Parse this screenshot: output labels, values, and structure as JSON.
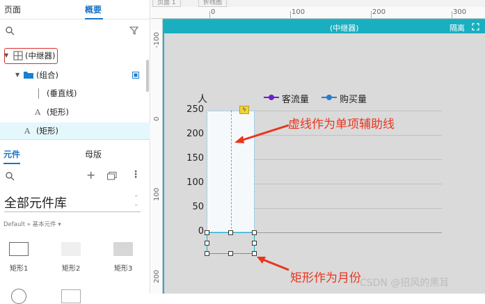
{
  "left_panel": {
    "tabs": [
      {
        "label": "页面"
      },
      {
        "label": "概要"
      }
    ],
    "outline": [
      {
        "label": "(中继器)"
      },
      {
        "label": "(组合)"
      },
      {
        "label": "(垂直线)"
      },
      {
        "label": "(矩形)"
      },
      {
        "label": "(矩形)"
      }
    ],
    "lib_tabs": [
      {
        "label": "元件"
      },
      {
        "label": "母版"
      }
    ],
    "library_title": "全部元件库",
    "library_path": "Default » 基本元件 ▾",
    "components": [
      {
        "label": "矩形1"
      },
      {
        "label": "矩形2"
      },
      {
        "label": "矩形3"
      }
    ]
  },
  "canvas": {
    "doc_tabs": [
      {
        "label": "页面 1"
      },
      {
        "label": "折线图"
      }
    ],
    "hruler_labels": [
      "0",
      "100",
      "200",
      "300"
    ],
    "vruler_labels": [
      "-100",
      "0",
      "100",
      "200"
    ],
    "repeater_title": "(中继器)",
    "isolate_label": "隔离"
  },
  "chart_data": {
    "type": "line",
    "ylabel": "人",
    "yticks": [
      "250",
      "200",
      "150",
      "100",
      "50",
      "0"
    ],
    "ylim": [
      0,
      250
    ],
    "series": [
      {
        "name": "客流量",
        "color": "#6a1fd0"
      },
      {
        "name": "购买量",
        "color": "#2b7bd6"
      }
    ],
    "grid": true,
    "legend_position": "top"
  },
  "annotations": {
    "dashed_note": "虚线作为单项辅助线",
    "rect_note": "矩形作为月份",
    "watermark": "CSDN @招风的黑耳"
  }
}
